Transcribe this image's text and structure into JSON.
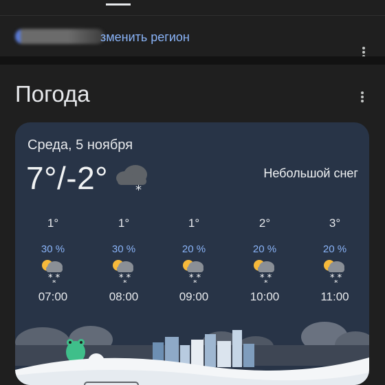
{
  "region": {
    "link_label": "зменить регион"
  },
  "weather": {
    "section_title": "Погода",
    "date": "Среда, 5 ноября",
    "temps": "7°/-2°",
    "condition": "Небольшой снег",
    "current_icon": "cloud-snow-icon",
    "hourly": [
      {
        "temp": "1°",
        "precip": "30 %",
        "time": "07:00",
        "icon": "partly-sunny-snow-icon"
      },
      {
        "temp": "1°",
        "precip": "30 %",
        "time": "08:00",
        "icon": "partly-sunny-snow-icon"
      },
      {
        "temp": "1°",
        "precip": "20 %",
        "time": "09:00",
        "icon": "partly-sunny-snow-icon"
      },
      {
        "temp": "2°",
        "precip": "20 %",
        "time": "10:00",
        "icon": "partly-sunny-snow-icon"
      },
      {
        "temp": "3°",
        "precip": "20 %",
        "time": "11:00",
        "icon": "partly-sunny-snow-icon"
      }
    ]
  },
  "colors": {
    "background": "#1f1f1f",
    "card": "#283447",
    "link": "#8ab4f8",
    "precip": "#8ab4f8"
  }
}
